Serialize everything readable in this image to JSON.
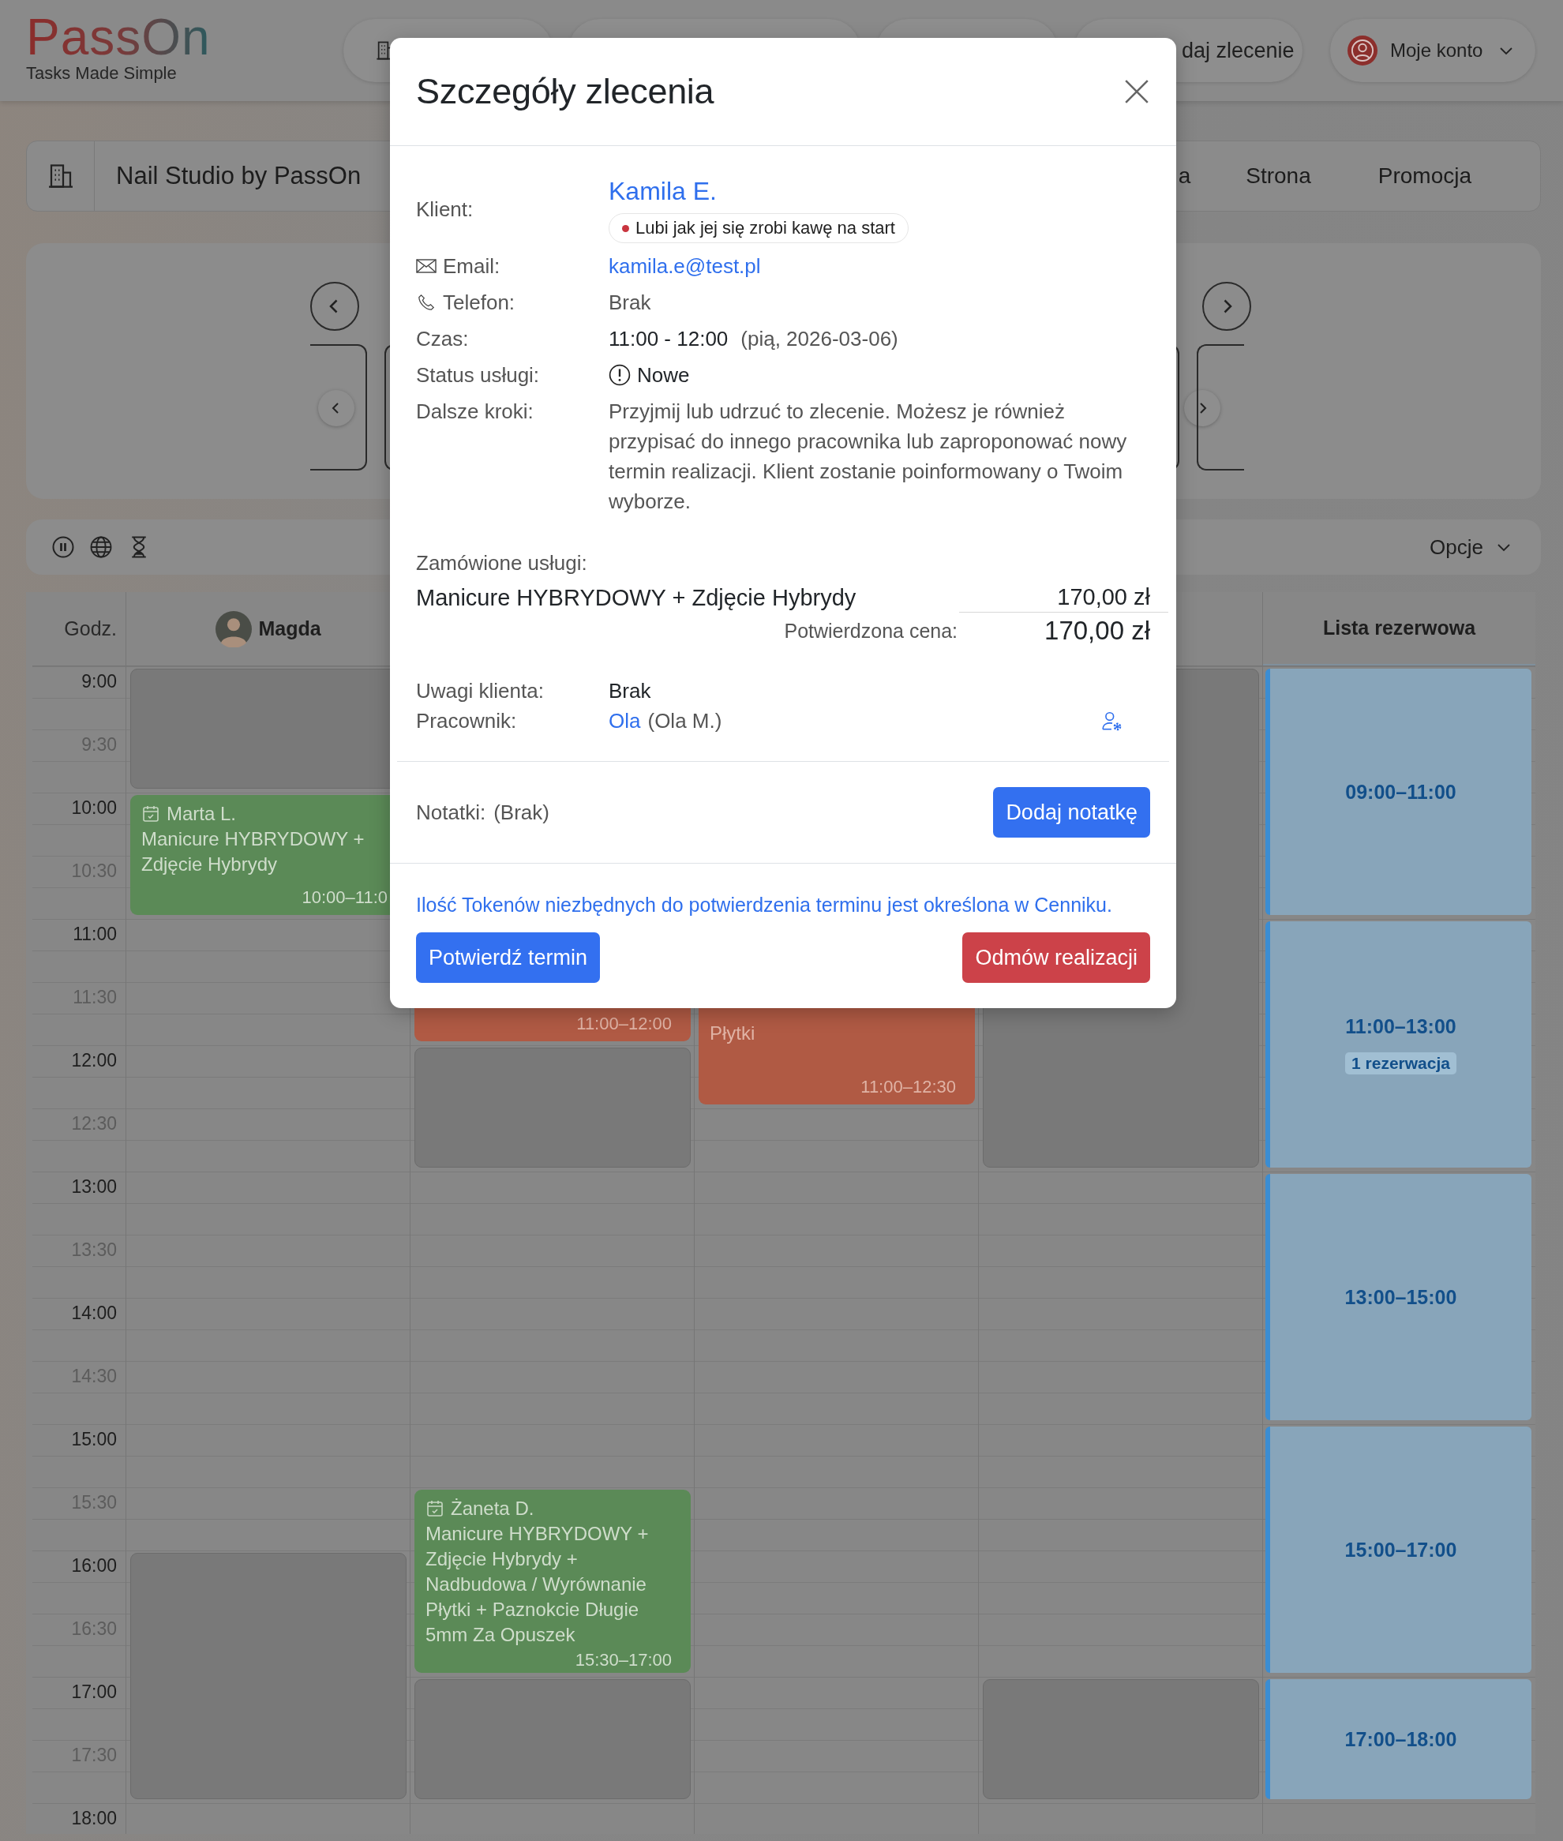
{
  "header": {
    "logo": "PassOn",
    "tagline": "Tasks Made Simple",
    "action_label": "daj zlecenie",
    "account_label": "Moje konto"
  },
  "business": {
    "name": "Nail Studio by PassOn",
    "links": [
      "a",
      "Strona",
      "Promocja"
    ]
  },
  "toolbar": {
    "options_label": "Opcje"
  },
  "calendar": {
    "time_header": "Godz.",
    "columns": [
      {
        "kind": "staff",
        "name": "Magda"
      },
      {
        "kind": "staff"
      },
      {
        "kind": "staff"
      },
      {
        "kind": "staff"
      },
      {
        "kind": "waitlist",
        "name": "Lista rezerwowa"
      }
    ],
    "times": [
      {
        "kind": "hour",
        "label": "9:00",
        "cells": [
          {
            "kind": "blocked"
          },
          {
            "kind": "free"
          },
          {
            "kind": "free"
          },
          {
            "kind": "blocked"
          },
          {
            "kind": "waitlist",
            "label": "09:00–11:00"
          }
        ]
      },
      {
        "kind": "half",
        "label": "9:30",
        "cells": [
          {
            "kind": "continued"
          },
          {
            "kind": "free"
          },
          {
            "kind": "free"
          },
          {
            "kind": "continued"
          },
          {
            "kind": "continued"
          }
        ]
      },
      {
        "kind": "hour",
        "label": "10:00",
        "cells": [
          {
            "kind": "booking",
            "color": "#5b8a57",
            "title": "Marta L.",
            "services": "Manicure HYBRYDOWY + Zdjęcie Hybrydy",
            "time": "10:00–11:0"
          },
          {
            "kind": "free"
          },
          {
            "kind": "free"
          },
          {
            "kind": "continued"
          },
          {
            "kind": "continued"
          }
        ]
      },
      {
        "kind": "half",
        "label": "10:30",
        "cells": [
          {
            "kind": "continued"
          },
          {
            "kind": "free"
          },
          {
            "kind": "free"
          },
          {
            "kind": "continued"
          },
          {
            "kind": "continued"
          }
        ]
      },
      {
        "kind": "hour",
        "label": "11:00",
        "cells": [
          {
            "kind": "free"
          },
          {
            "kind": "booking",
            "color": "#b05a44",
            "time": "11:00–12:00"
          },
          {
            "kind": "booking",
            "color": "#b05a44",
            "services": "Płytki",
            "time": "11:00–12:30"
          },
          {
            "kind": "continued"
          },
          {
            "kind": "waitlist",
            "label": "11:00–13:00",
            "badge": "1 rezerwacja"
          }
        ]
      },
      {
        "kind": "half",
        "label": "11:30",
        "cells": [
          {
            "kind": "free"
          },
          {
            "kind": "continued"
          },
          {
            "kind": "continued"
          },
          {
            "kind": "continued"
          },
          {
            "kind": "continued"
          }
        ]
      },
      {
        "kind": "hour",
        "label": "12:00",
        "cells": [
          {
            "kind": "free"
          },
          {
            "kind": "blocked"
          },
          {
            "kind": "continued"
          },
          {
            "kind": "continued"
          },
          {
            "kind": "continued"
          }
        ]
      },
      {
        "kind": "half",
        "label": "12:30",
        "cells": [
          {
            "kind": "free"
          },
          {
            "kind": "continued"
          },
          {
            "kind": "free"
          },
          {
            "kind": "continued"
          },
          {
            "kind": "continued"
          }
        ]
      },
      {
        "kind": "hour",
        "label": "13:00",
        "cells": [
          {
            "kind": "free"
          },
          {
            "kind": "free"
          },
          {
            "kind": "free"
          },
          {
            "kind": "free"
          },
          {
            "kind": "waitlist",
            "label": "13:00–15:00"
          }
        ]
      },
      {
        "kind": "half",
        "label": "13:30",
        "cells": [
          {
            "kind": "free"
          },
          {
            "kind": "free"
          },
          {
            "kind": "free"
          },
          {
            "kind": "free"
          },
          {
            "kind": "continued"
          }
        ]
      },
      {
        "kind": "hour",
        "label": "14:00",
        "cells": [
          {
            "kind": "free"
          },
          {
            "kind": "free"
          },
          {
            "kind": "free"
          },
          {
            "kind": "free"
          },
          {
            "kind": "continued"
          }
        ]
      },
      {
        "kind": "half",
        "label": "14:30",
        "cells": [
          {
            "kind": "free"
          },
          {
            "kind": "free"
          },
          {
            "kind": "free"
          },
          {
            "kind": "free"
          },
          {
            "kind": "continued"
          }
        ]
      },
      {
        "kind": "hour",
        "label": "15:00",
        "cells": [
          {
            "kind": "free"
          },
          {
            "kind": "free"
          },
          {
            "kind": "free"
          },
          {
            "kind": "free"
          },
          {
            "kind": "waitlist",
            "label": "15:00–17:00"
          }
        ]
      },
      {
        "kind": "half",
        "label": "15:30",
        "cells": [
          {
            "kind": "free"
          },
          {
            "kind": "booking",
            "color": "#5b8a57",
            "title": "Żaneta D.",
            "services": "Manicure HYBRYDOWY + Zdjęcie Hybrydy + Nadbudowa / Wyrównanie Płytki + Paznokcie Długie 5mm Za Opuszek",
            "time": "15:30–17:00"
          },
          {
            "kind": "free"
          },
          {
            "kind": "free"
          },
          {
            "kind": "continued"
          }
        ]
      },
      {
        "kind": "hour",
        "label": "16:00",
        "cells": [
          {
            "kind": "blocked"
          },
          {
            "kind": "continued"
          },
          {
            "kind": "free"
          },
          {
            "kind": "free"
          },
          {
            "kind": "continued"
          }
        ]
      },
      {
        "kind": "half",
        "label": "16:30",
        "cells": [
          {
            "kind": "continued"
          },
          {
            "kind": "continued"
          },
          {
            "kind": "free"
          },
          {
            "kind": "free"
          },
          {
            "kind": "continued"
          }
        ]
      },
      {
        "kind": "hour",
        "label": "17:00",
        "cells": [
          {
            "kind": "continued"
          },
          {
            "kind": "blocked"
          },
          {
            "kind": "free"
          },
          {
            "kind": "blocked"
          },
          {
            "kind": "waitlist",
            "label": "17:00–18:00"
          }
        ]
      },
      {
        "kind": "half",
        "label": "17:30",
        "cells": [
          {
            "kind": "continued"
          },
          {
            "kind": "continued"
          },
          {
            "kind": "free"
          },
          {
            "kind": "continued"
          },
          {
            "kind": "continued"
          }
        ]
      },
      {
        "kind": "hour",
        "label": "18:00"
      }
    ]
  },
  "modal": {
    "title": "Szczegóły zlecenia",
    "client": {
      "label": "Klient:",
      "name": "Kamila E.",
      "tag": "Lubi jak jej się zrobi kawę na start"
    },
    "fields": [
      {
        "kind": "email",
        "label": "Email:",
        "value": "kamila.e@test.pl"
      },
      {
        "kind": "phone",
        "label": "Telefon:",
        "value": "Brak"
      },
      {
        "kind": "time",
        "label": "Czas:",
        "value": "11:00 - 12:00",
        "extra": "(pią, 2026-03-06)"
      },
      {
        "kind": "status",
        "label": "Status usługi:",
        "value": "Nowe"
      },
      {
        "kind": "text",
        "label": "Dalsze kroki:",
        "value": "Przyjmij lub udrzuć to zlecenie. Możesz je również przypisać do innego pracownika lub zaproponować nowy termin realizacji. Klient zostanie poinformowany o Twoim wyborze."
      }
    ],
    "services_label": "Zamówione usługi:",
    "services": [
      {
        "name": "Manicure HYBRYDOWY + Zdjęcie Hybrydy",
        "price": "170,00 zł"
      }
    ],
    "confirmed_label": "Potwierdzona cena:",
    "confirmed_price": "170,00 zł",
    "extra_fields": [
      {
        "kind": "plain",
        "label": "Uwagi klienta:",
        "value": "Brak"
      },
      {
        "kind": "worker",
        "label": "Pracownik:",
        "value": "Ola",
        "extra": "(Ola M.)"
      }
    ],
    "notes": {
      "label": "Notatki:",
      "value": "(Brak)",
      "button": "Dodaj notatkę"
    },
    "info": "Ilość Tokenów niezbędnych do potwierdzenia terminu jest określona w Cenniku.",
    "confirm_button": "Potwierdź termin",
    "reject_button": "Odmów realizacji"
  }
}
